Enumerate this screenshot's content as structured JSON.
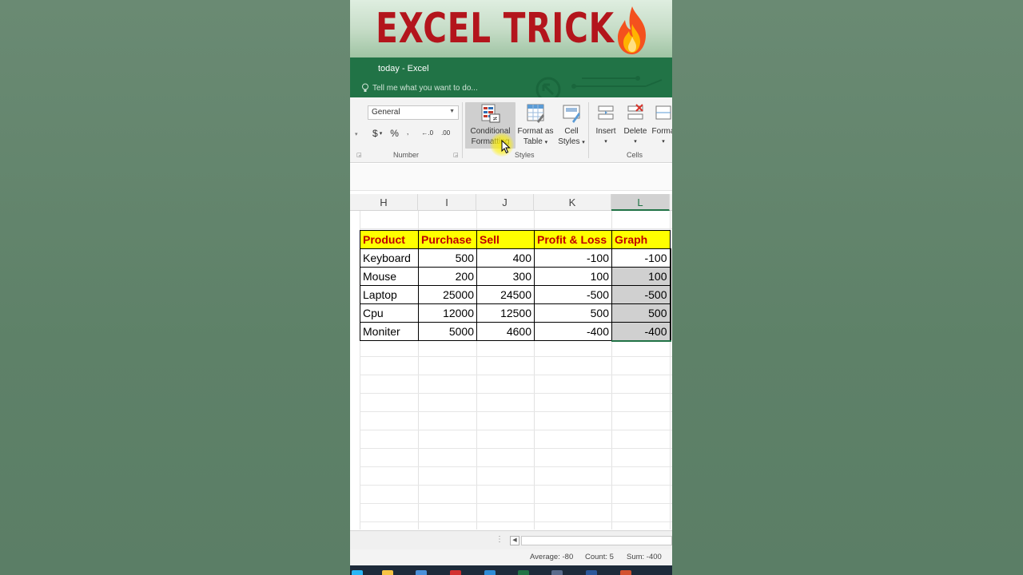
{
  "banner": {
    "title": "EXCEL TRICK",
    "icon": "fire-icon"
  },
  "window": {
    "title": "today - Excel",
    "tell_me": "Tell me what you want to do..."
  },
  "ribbon": {
    "number_format": "General",
    "number_buttons": [
      "$",
      "%",
      "⁹",
      "←.0",
      ".00"
    ],
    "groups": {
      "number": "Number",
      "styles": "Styles",
      "cells": "Cells"
    },
    "buttons": {
      "conditional_formatting": [
        "Conditional",
        "Formatting"
      ],
      "format_as_table": [
        "Format as",
        "Table"
      ],
      "cell_styles": [
        "Cell",
        "Styles"
      ],
      "insert": "Insert",
      "delete": "Delete",
      "format": "Forma"
    }
  },
  "sheet": {
    "columns": [
      "H",
      "I",
      "J",
      "K",
      "L"
    ],
    "selected_column": "L",
    "headers": [
      "Product",
      "Purchase",
      "Sell",
      "Profit & Loss",
      "Graph"
    ],
    "rows": [
      [
        "Keyboard",
        "500",
        "400",
        "-100",
        "-100"
      ],
      [
        "Mouse",
        "200",
        "300",
        "100",
        "100"
      ],
      [
        "Laptop",
        "25000",
        "24500",
        "-500",
        "-500"
      ],
      [
        "Cpu",
        "12000",
        "12500",
        "500",
        "500"
      ],
      [
        "Moniter",
        "5000",
        "4600",
        "-400",
        "-400"
      ]
    ],
    "colors": {
      "header_fill": "#ffff00",
      "header_text": "#c00000",
      "excel_green": "#217346"
    }
  },
  "status": {
    "average": "Average: -80",
    "count": "Count: 5",
    "sum": "Sum: -400"
  }
}
